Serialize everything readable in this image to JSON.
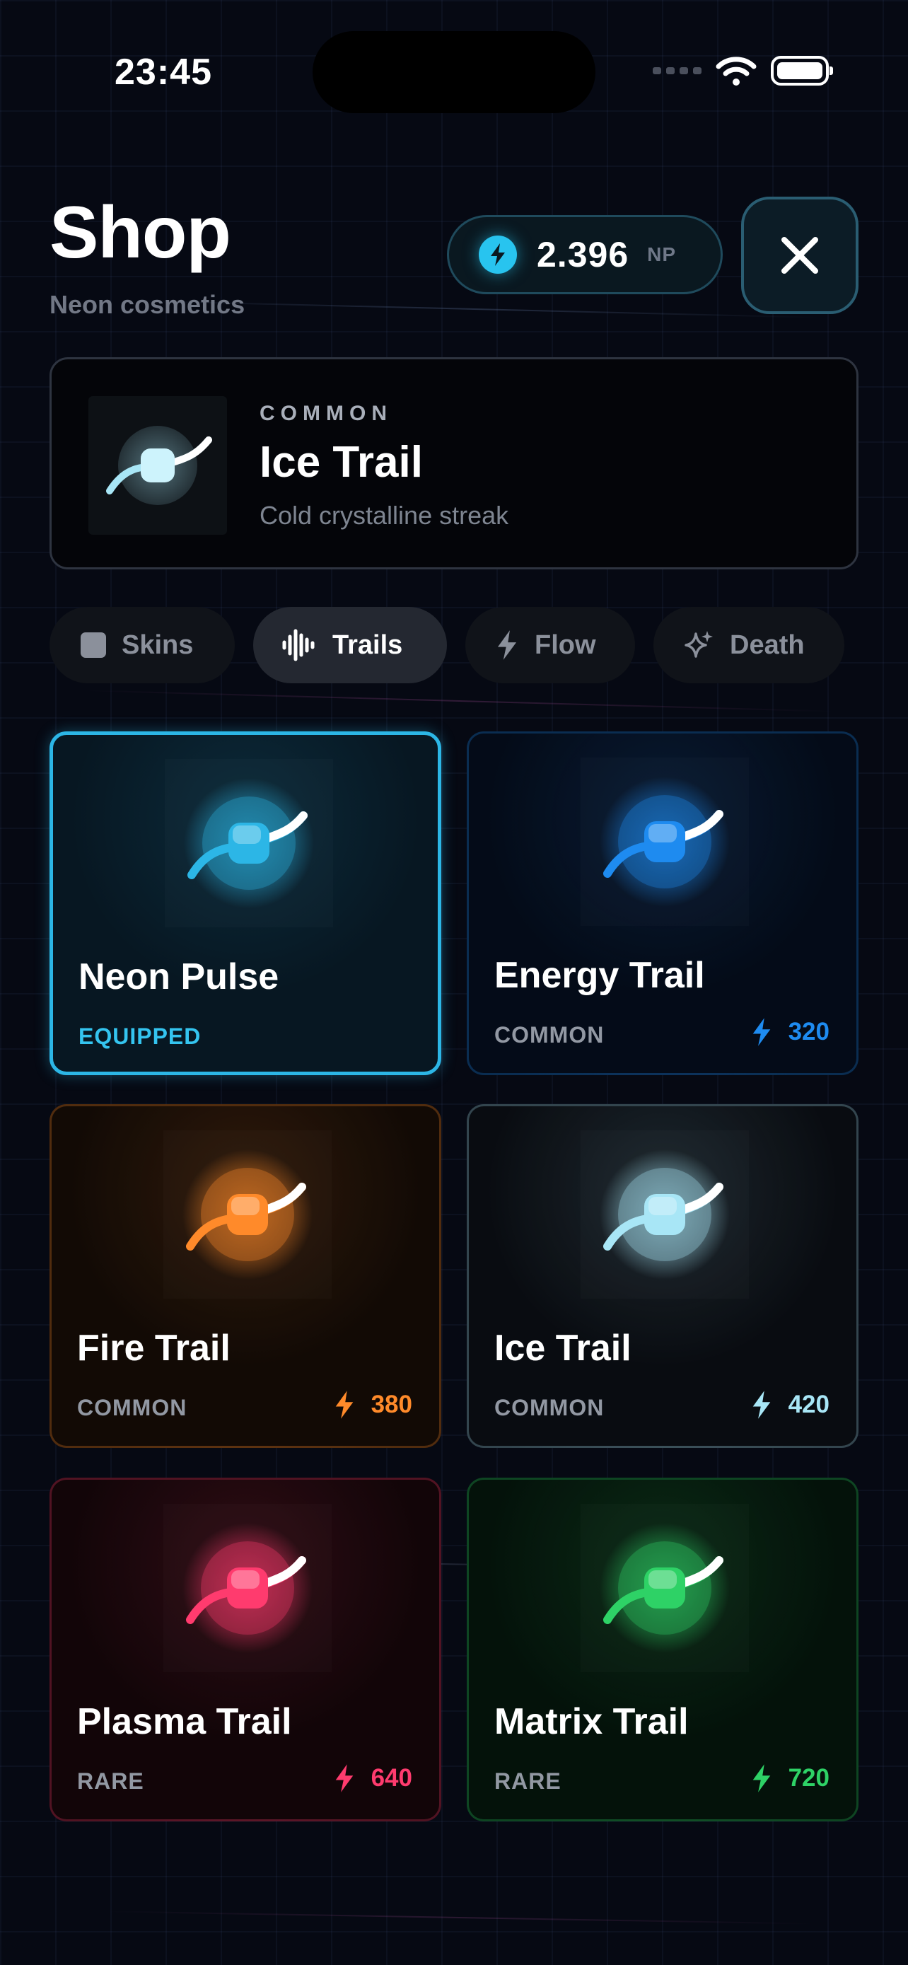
{
  "status_bar": {
    "time": "23:45"
  },
  "header": {
    "title": "Shop",
    "subtitle": "Neon cosmetics",
    "balance": "2.396",
    "balance_unit": "NP"
  },
  "featured": {
    "rarity": "COMMON",
    "name": "Ice Trail",
    "description": "Cold crystalline streak"
  },
  "tabs": [
    {
      "label": "Skins",
      "icon": "square-icon",
      "active": false
    },
    {
      "label": "Trails",
      "icon": "waveform-icon",
      "active": true
    },
    {
      "label": "Flow",
      "icon": "bolt-icon",
      "active": false
    },
    {
      "label": "Death",
      "icon": "sparkles-icon",
      "active": false
    }
  ],
  "items": [
    {
      "name": "Neon Pulse",
      "rarity": "EQUIPPED",
      "price": "",
      "color": "#2cb6e6",
      "equipped": true
    },
    {
      "name": "Energy Trail",
      "rarity": "COMMON",
      "price": "320",
      "color": "#1e8bf0"
    },
    {
      "name": "Fire Trail",
      "rarity": "COMMON",
      "price": "380",
      "color": "#ff8a2a"
    },
    {
      "name": "Ice Trail",
      "rarity": "COMMON",
      "price": "420",
      "color": "#a8e6f6"
    },
    {
      "name": "Plasma Trail",
      "rarity": "RARE",
      "price": "640",
      "color": "#ff3b6e"
    },
    {
      "name": "Matrix Trail",
      "rarity": "RARE",
      "price": "720",
      "color": "#2ed266"
    }
  ]
}
